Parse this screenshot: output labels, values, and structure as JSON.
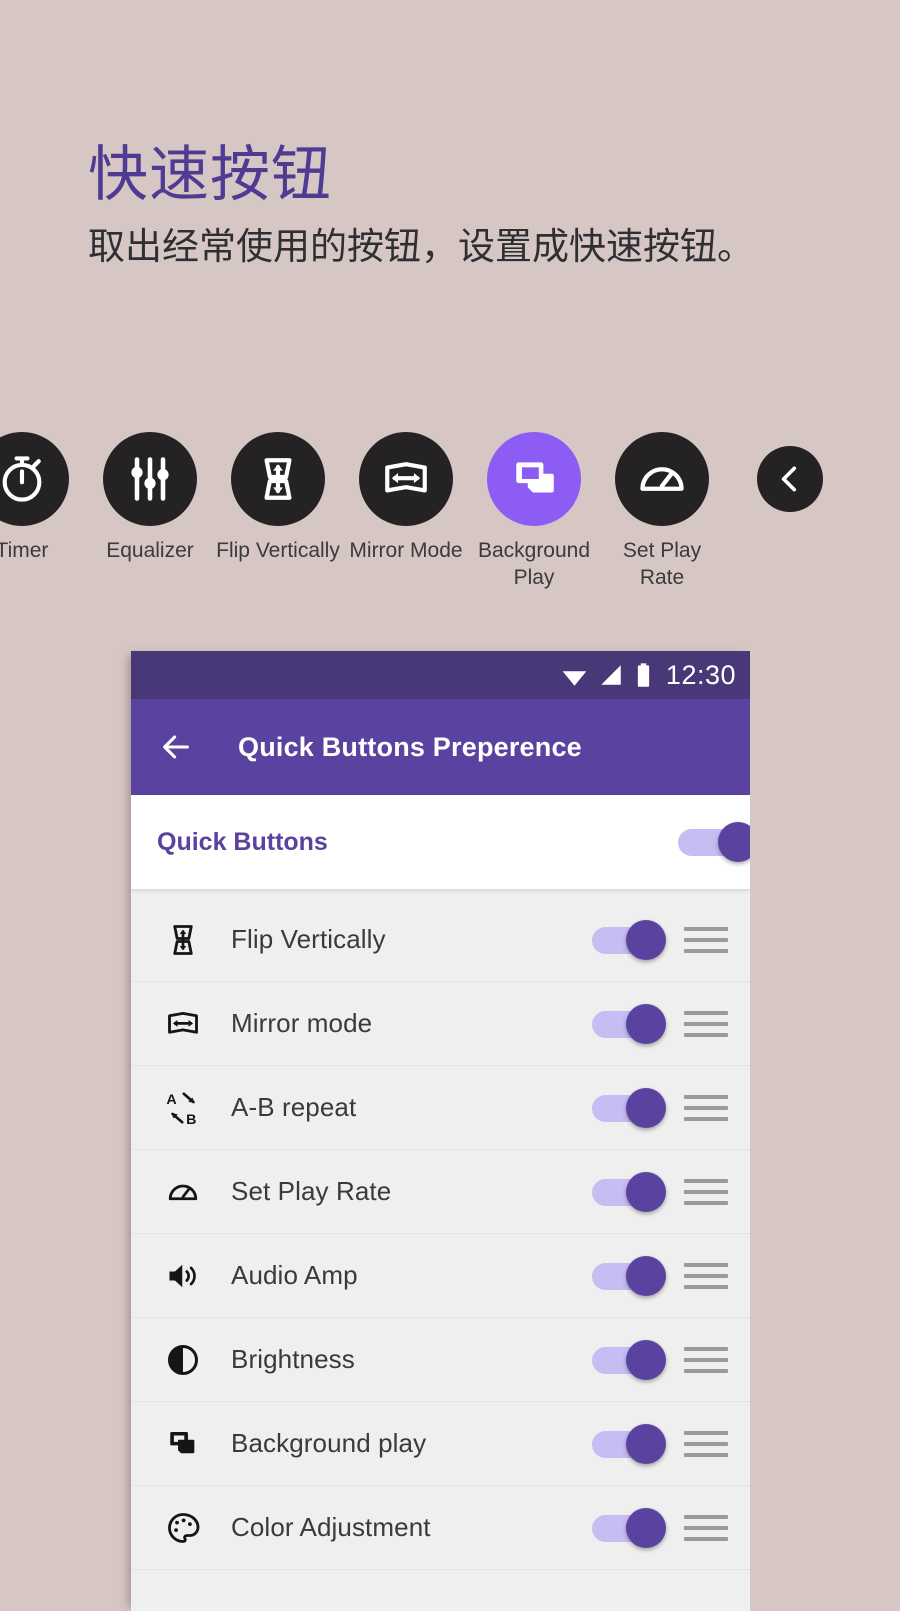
{
  "promo": {
    "title": "快速按钮",
    "subtitle": "取出经常使用的按钮，设置成快速按钮。"
  },
  "colors": {
    "page_background": "#d6c7c5",
    "heading_purple": "#4f3b91",
    "appbar_purple": "#5a43a0",
    "statusbar_purple": "#483878",
    "accent_highlight": "#8c5cf5",
    "icon_circle_dark": "#252223",
    "toggle_track": "#c6bdf2",
    "toggle_thumb": "#5a43a0",
    "list_background": "#efefef"
  },
  "icon_strip": [
    {
      "label": "Timer",
      "icon": "timer-icon",
      "highlighted": false,
      "partially_cut": true
    },
    {
      "label": "Equalizer",
      "icon": "equalizer-icon",
      "highlighted": false
    },
    {
      "label": "Flip Vertically",
      "icon": "flip-vertically-icon",
      "highlighted": false
    },
    {
      "label": "Mirror Mode",
      "icon": "mirror-mode-icon",
      "highlighted": false
    },
    {
      "label": "Background Play",
      "icon": "background-play-icon",
      "highlighted": true
    },
    {
      "label": "Set Play Rate",
      "icon": "set-play-rate-icon",
      "highlighted": false
    },
    {
      "label": "",
      "icon": "chevron-left-icon",
      "highlighted": false
    }
  ],
  "phone": {
    "statusbar": {
      "time": "12:30",
      "icons": [
        "wifi-icon",
        "signal-icon",
        "battery-icon"
      ]
    },
    "appbar": {
      "back_icon": "back-arrow-icon",
      "title": "Quick Buttons Preperence"
    },
    "master": {
      "label": "Quick Buttons",
      "enabled": true
    },
    "rows": [
      {
        "label": "Flip Vertically",
        "icon": "flip-vertically-icon",
        "enabled": true,
        "handle": "drag-handle-icon"
      },
      {
        "label": "Mirror mode",
        "icon": "mirror-mode-icon",
        "enabled": true,
        "handle": "drag-handle-icon"
      },
      {
        "label": "A-B repeat",
        "icon": "ab-repeat-icon",
        "enabled": true,
        "handle": "drag-handle-icon"
      },
      {
        "label": "Set Play Rate",
        "icon": "set-play-rate-icon",
        "enabled": true,
        "handle": "drag-handle-icon"
      },
      {
        "label": "Audio Amp",
        "icon": "audio-amp-icon",
        "enabled": true,
        "handle": "drag-handle-icon"
      },
      {
        "label": "Brightness",
        "icon": "brightness-icon",
        "enabled": true,
        "handle": "drag-handle-icon"
      },
      {
        "label": "Background play",
        "icon": "background-play-icon",
        "enabled": true,
        "handle": "drag-handle-icon"
      },
      {
        "label": "Color Adjustment",
        "icon": "color-adjustment-icon",
        "enabled": true,
        "handle": "drag-handle-icon"
      }
    ]
  }
}
